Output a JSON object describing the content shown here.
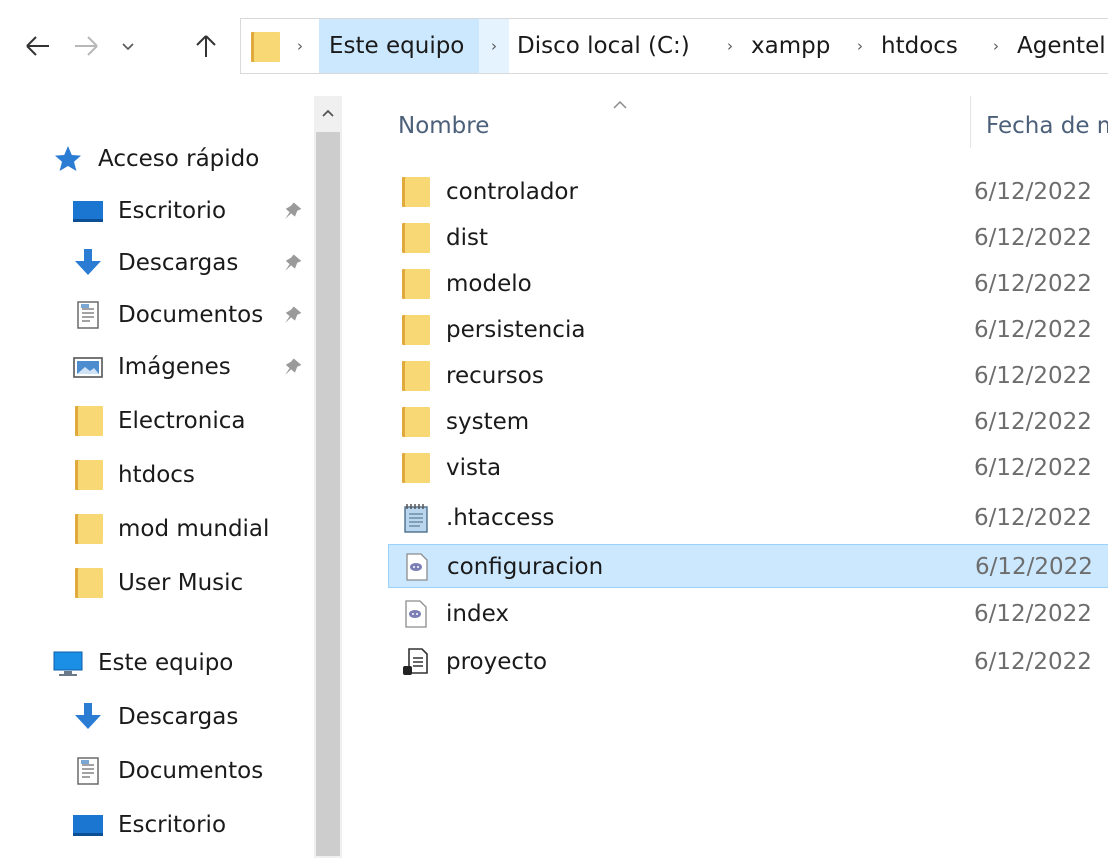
{
  "breadcrumbs": [
    "Este equipo",
    "Disco local (C:)",
    "xampp",
    "htdocs",
    "Agentel"
  ],
  "sidebar": {
    "quick_access": "Acceso rápido",
    "pinned": [
      {
        "label": "Escritorio",
        "icon": "desktop-icon"
      },
      {
        "label": "Descargas",
        "icon": "download-arrow-icon"
      },
      {
        "label": "Documentos",
        "icon": "documents-icon"
      },
      {
        "label": "Imágenes",
        "icon": "pictures-icon"
      }
    ],
    "folders": [
      "Electronica",
      "htdocs",
      "mod mundial",
      "User Music"
    ],
    "this_pc": "Este equipo",
    "pc_items": [
      {
        "label": "Descargas",
        "icon": "download-arrow-icon"
      },
      {
        "label": "Documentos",
        "icon": "documents-icon"
      },
      {
        "label": "Escritorio",
        "icon": "desktop-icon"
      }
    ]
  },
  "columns": {
    "name": "Nombre",
    "date": "Fecha de m"
  },
  "files": [
    {
      "name": "controlador",
      "date": "6/12/2022",
      "icon": "folder-icon"
    },
    {
      "name": "dist",
      "date": "6/12/2022",
      "icon": "folder-icon"
    },
    {
      "name": "modelo",
      "date": "6/12/2022",
      "icon": "folder-icon"
    },
    {
      "name": "persistencia",
      "date": "6/12/2022",
      "icon": "folder-icon"
    },
    {
      "name": "recursos",
      "date": "6/12/2022",
      "icon": "folder-icon"
    },
    {
      "name": "system",
      "date": "6/12/2022",
      "icon": "folder-icon"
    },
    {
      "name": "vista",
      "date": "6/12/2022",
      "icon": "folder-icon"
    },
    {
      "name": ".htaccess",
      "date": "6/12/2022",
      "icon": "notepad-icon"
    },
    {
      "name": "configuracion",
      "date": "6/12/2022",
      "icon": "php-file-icon",
      "selected": true
    },
    {
      "name": "index",
      "date": "6/12/2022",
      "icon": "php-file-icon"
    },
    {
      "name": "proyecto",
      "date": "6/12/2022",
      "icon": "text-document-icon"
    }
  ],
  "colors": {
    "folder_yellow": "#f8d775",
    "folder_dark": "#e0a93b",
    "selection_bg": "#cce8ff",
    "selection_border": "#99d1ff",
    "header_text": "#4c607a",
    "quick_access_star": "#2b7cd3"
  }
}
